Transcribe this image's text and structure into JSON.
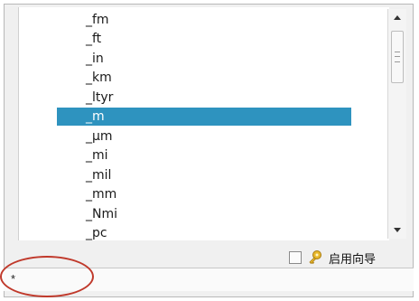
{
  "list": {
    "items": [
      {
        "label": "_fm",
        "selected": false
      },
      {
        "label": "_ft",
        "selected": false
      },
      {
        "label": "_in",
        "selected": false
      },
      {
        "label": "_km",
        "selected": false
      },
      {
        "label": "_ltyr",
        "selected": false
      },
      {
        "label": "_m",
        "selected": true
      },
      {
        "label": "_µm",
        "selected": false
      },
      {
        "label": "_mi",
        "selected": false
      },
      {
        "label": "_mil",
        "selected": false
      },
      {
        "label": "_mm",
        "selected": false
      },
      {
        "label": "_Nmi",
        "selected": false
      },
      {
        "label": "_pc",
        "selected": false
      }
    ]
  },
  "scrollbar": {
    "up_icon": "triangle-up",
    "down_icon": "triangle-down"
  },
  "toolbar": {
    "wizard_label": "启用向导",
    "wizard_icon": "key-icon"
  },
  "command_line": {
    "text": "*"
  },
  "colors": {
    "selection": "#2e93bf",
    "annotation": "#c0392b"
  }
}
